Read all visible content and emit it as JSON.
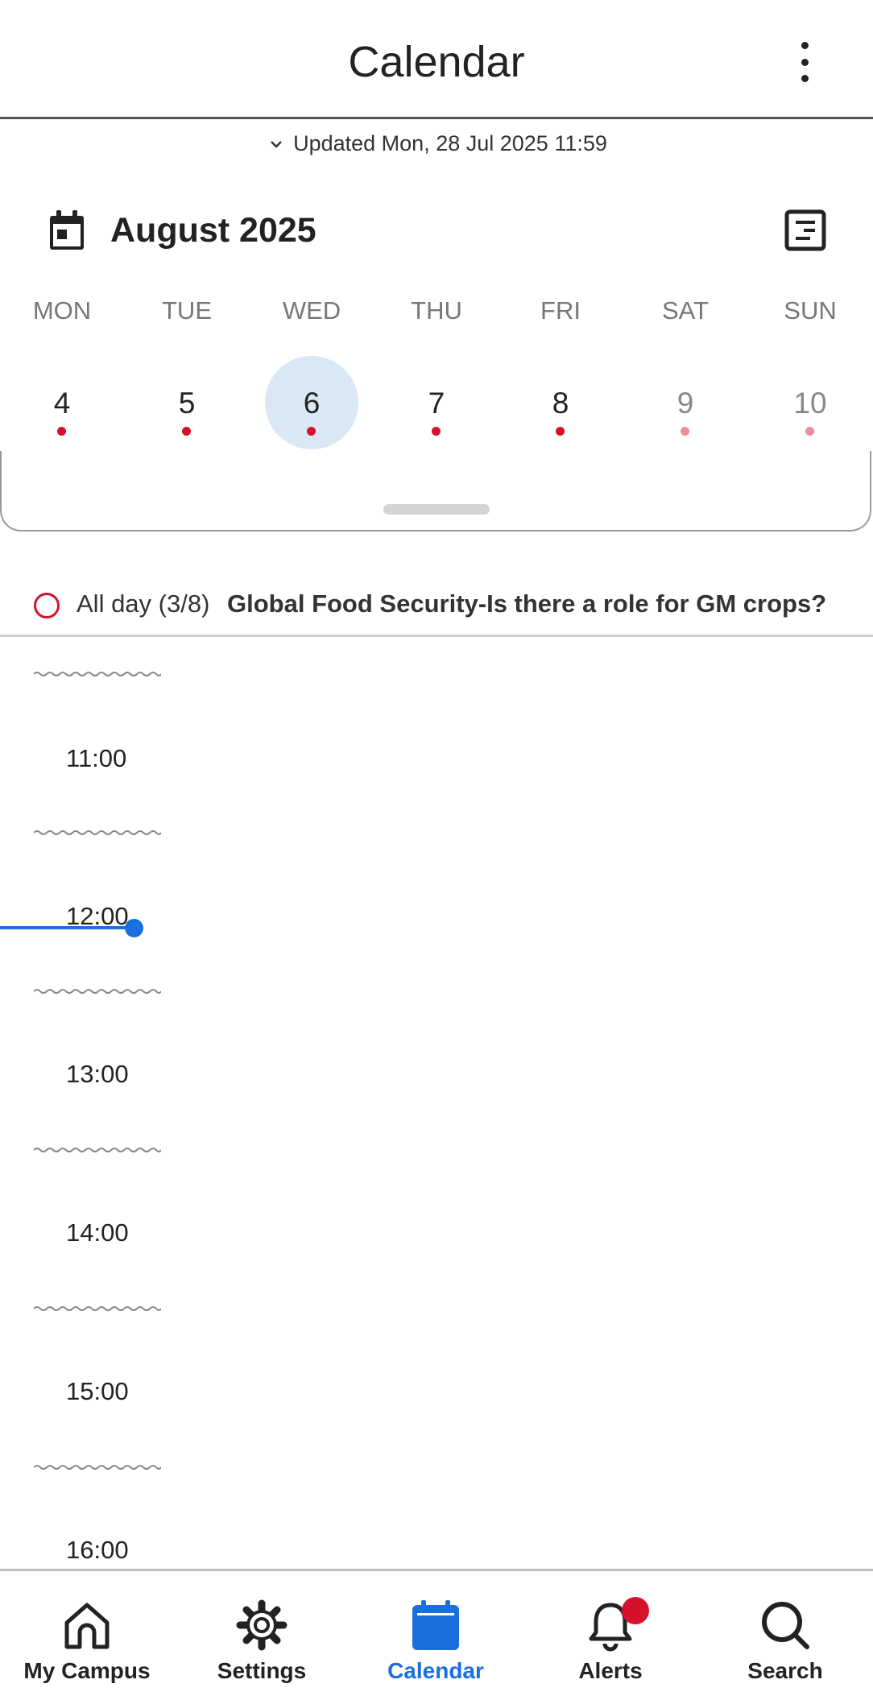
{
  "appbar": {
    "title": "Calendar"
  },
  "updated": {
    "text": "Updated Mon, 28 Jul 2025 11:59"
  },
  "month": {
    "label": "August 2025"
  },
  "week": {
    "days": [
      {
        "weekday": "MON",
        "date": "4",
        "has_events": true
      },
      {
        "weekday": "TUE",
        "date": "5",
        "has_events": true
      },
      {
        "weekday": "WED",
        "date": "6",
        "has_events": true,
        "selected": true
      },
      {
        "weekday": "THU",
        "date": "7",
        "has_events": true
      },
      {
        "weekday": "FRI",
        "date": "8",
        "has_events": true
      },
      {
        "weekday": "SAT",
        "date": "9",
        "has_events": true
      },
      {
        "weekday": "SUN",
        "date": "10",
        "has_events": true
      }
    ]
  },
  "allday": {
    "label": "All day (3/8)",
    "title": "Global Food Security-Is there a role for GM crops?"
  },
  "timeline": {
    "hours": [
      "11:00",
      "12:00",
      "13:00",
      "14:00",
      "15:00",
      "16:00"
    ],
    "current_time_indicator": "12:00"
  },
  "bottom_nav": {
    "items": [
      {
        "label": "My Campus",
        "icon": "home-icon"
      },
      {
        "label": "Settings",
        "icon": "gear-icon"
      },
      {
        "label": "Calendar",
        "icon": "calendar-icon",
        "active": true
      },
      {
        "label": "Alerts",
        "icon": "bell-icon",
        "badge": true
      },
      {
        "label": "Search",
        "icon": "search-icon"
      }
    ]
  },
  "colors": {
    "accent": "#1a6fe0",
    "event_dot": "#d6112a",
    "selected_day_bg": "#dae7f5"
  }
}
